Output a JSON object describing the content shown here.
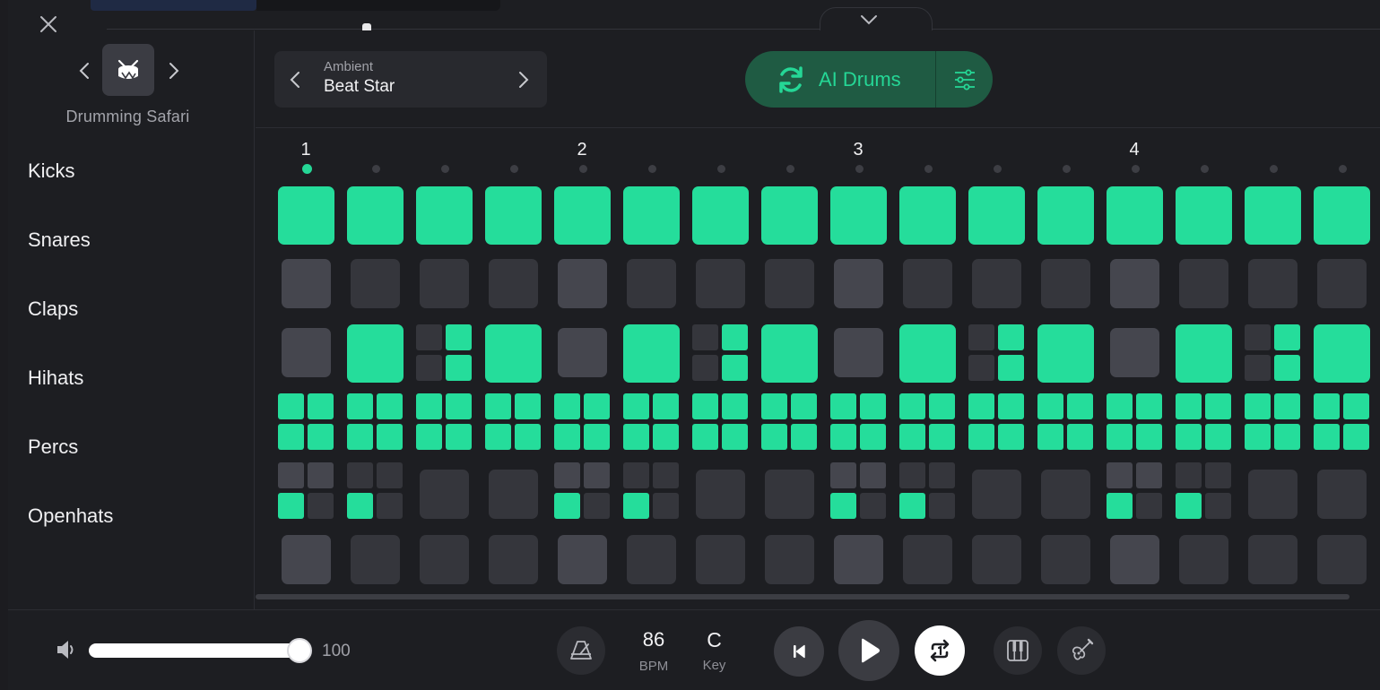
{
  "kit": {
    "name": "Drumming Safari"
  },
  "pattern": {
    "genre": "Ambient",
    "name": "Beat Star"
  },
  "ai": {
    "label": "AI Drums"
  },
  "beats": [
    "1",
    "2",
    "3",
    "4"
  ],
  "current_step": 1,
  "tracks": [
    {
      "label": "Kicks",
      "steps": [
        "on",
        "on",
        "on",
        "on",
        "on",
        "on",
        "on",
        "on",
        "on",
        "on",
        "on",
        "on",
        "on",
        "on",
        "on",
        "on"
      ]
    },
    {
      "label": "Snares",
      "steps": [
        "hi",
        "off",
        "off",
        "off",
        "hi",
        "off",
        "off",
        "off",
        "hi",
        "off",
        "off",
        "off",
        "hi",
        "off",
        "off",
        "off"
      ]
    },
    {
      "label": "Claps",
      "steps": [
        "hi",
        "on",
        "sub:0101",
        "on",
        "hi",
        "on",
        "sub:0101",
        "on",
        "hi",
        "on",
        "sub:0101",
        "on",
        "hi",
        "on",
        "sub:0101",
        "on"
      ]
    },
    {
      "label": "Hihats",
      "steps": [
        "sub:1111",
        "sub:1111",
        "sub:1111",
        "sub:1111",
        "sub:1111",
        "sub:1111",
        "sub:1111",
        "sub:1111",
        "sub:1111",
        "sub:1111",
        "sub:1111",
        "sub:1111",
        "sub:1111",
        "sub:1111",
        "sub:1111",
        "sub:1111"
      ]
    },
    {
      "label": "Percs",
      "steps": [
        "sub:2210",
        "sub:0010",
        "off",
        "off",
        "sub:2210",
        "sub:0010",
        "off",
        "off",
        "sub:2210",
        "sub:0010",
        "off",
        "off",
        "sub:2210",
        "sub:0010",
        "off",
        "off"
      ]
    },
    {
      "label": "Openhats",
      "steps": [
        "hi",
        "off",
        "off",
        "off",
        "hi",
        "off",
        "off",
        "off",
        "hi",
        "off",
        "off",
        "off",
        "hi",
        "off",
        "off",
        "off"
      ]
    }
  ],
  "volume": {
    "value": "100",
    "level": 1.0
  },
  "tempo": {
    "value": "86",
    "label": "BPM"
  },
  "key": {
    "value": "C",
    "label": "Key"
  },
  "colors": {
    "accent": "#25dd9b",
    "ai_pill": "#1f5b43",
    "cell_off": "#35363c",
    "cell_highlight": "#45464e",
    "background": "#1d1e22"
  },
  "icons": {
    "close": "close-icon",
    "collapse": "chevron-down-icon",
    "kit": "drum-icon",
    "prev": "chevron-left-icon",
    "next": "chevron-right-icon",
    "ai": "refresh-icon",
    "settings": "sliders-icon",
    "volume": "speaker-icon",
    "metronome": "metronome-icon",
    "restart": "skip-back-icon",
    "play": "play-icon",
    "loop": "loop-icon",
    "piano": "piano-icon",
    "guitar": "guitar-icon"
  }
}
